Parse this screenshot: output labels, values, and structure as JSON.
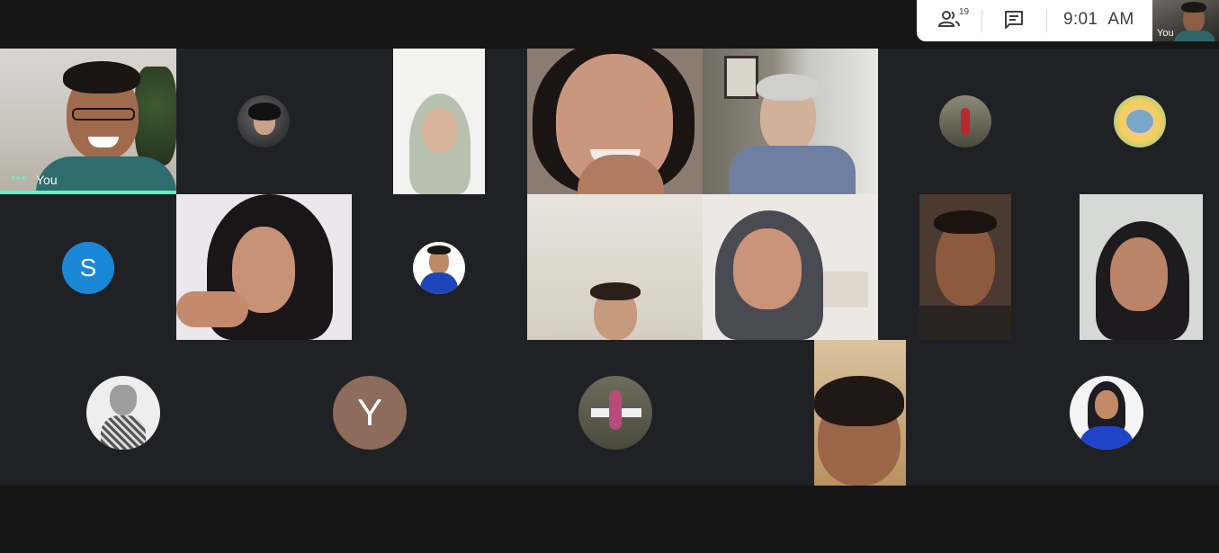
{
  "header": {
    "participants_count": "19",
    "time": "9:01",
    "ampm": "AM",
    "self_view_label": "You"
  },
  "tiles": {
    "self_label": "You",
    "avatar_s_initial": "S",
    "avatar_y_initial": "Y"
  },
  "colors": {
    "background": "#202124",
    "active_speaker": "#5ef5c0",
    "avatar_s": "#1a87d6",
    "avatar_y": "#8d6b5d"
  },
  "icons": [
    "people-icon",
    "chat-icon"
  ]
}
